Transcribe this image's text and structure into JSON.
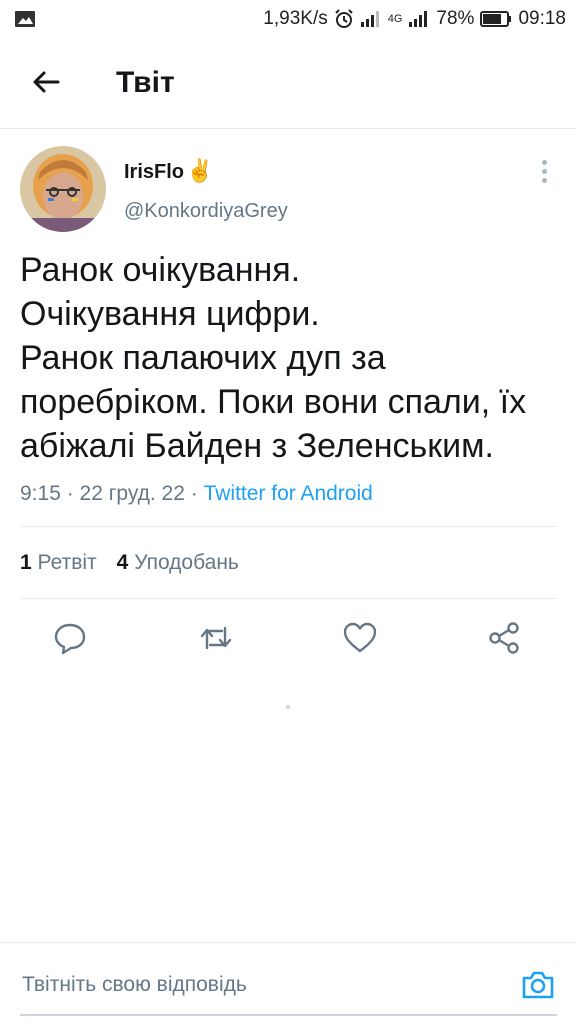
{
  "status_bar": {
    "speed": "1,93K/s",
    "network": "4G",
    "battery": "78%",
    "time": "09:18"
  },
  "header": {
    "title": "Твіт"
  },
  "tweet": {
    "display_name": "IrisFlo",
    "name_emoji": "✌️",
    "handle": "@KonkordiyaGrey",
    "text_lines": [
      "Ранок очікування.",
      "Очікування цифри.",
      "Ранок палаючих дуп за",
      "поребріком. Поки вони спали, їх",
      "абіжалі Байден з Зеленським."
    ],
    "meta_time": "9:15 · 22 груд. 22 · ",
    "source": "Twitter for Android",
    "retweets_count": "1",
    "retweets_label": "Ретвіт",
    "likes_count": "4",
    "likes_label": "Уподобань"
  },
  "reply": {
    "placeholder": "Твітніть свою відповідь"
  },
  "colors": {
    "accent": "#1da1f2",
    "secondary_text": "#657786",
    "primary_text": "#14171a",
    "divider": "#e6ecf0"
  },
  "icons": [
    "image-icon",
    "alarm-icon",
    "signal-icon",
    "battery-icon",
    "back-arrow-icon",
    "more-vertical-icon",
    "reply-icon",
    "retweet-icon",
    "like-icon",
    "share-icon",
    "camera-icon"
  ]
}
